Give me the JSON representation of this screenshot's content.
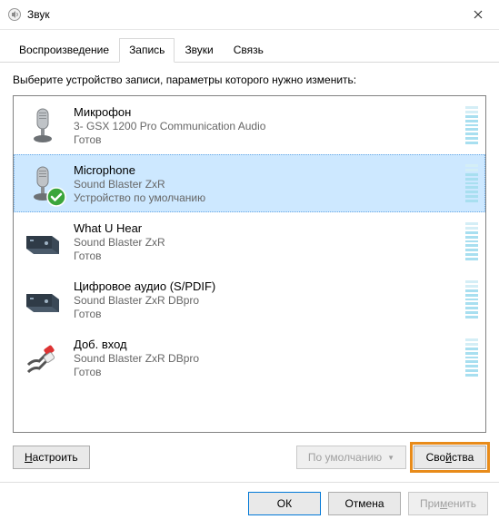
{
  "title": "Звук",
  "tabs": {
    "playback": "Воспроизведение",
    "recording": "Запись",
    "sounds": "Звуки",
    "communications": "Связь"
  },
  "active_tab": "recording",
  "prompt": "Выберите устройство записи, параметры которого нужно изменить:",
  "devices": [
    {
      "name": "Микрофон",
      "desc": "3- GSX 1200 Pro Communication Audio",
      "status": "Готов",
      "icon": "mic",
      "selected": false,
      "default": false
    },
    {
      "name": "Microphone",
      "desc": "Sound Blaster ZxR",
      "status": "Устройство по умолчанию",
      "icon": "mic",
      "selected": true,
      "default": true
    },
    {
      "name": "What U Hear",
      "desc": "Sound Blaster ZxR",
      "status": "Готов",
      "icon": "box",
      "selected": false,
      "default": false
    },
    {
      "name": "Цифровое аудио (S/PDIF)",
      "desc": "Sound Blaster ZxR DBpro",
      "status": "Готов",
      "icon": "box",
      "selected": false,
      "default": false
    },
    {
      "name": "Доб. вход",
      "desc": "Sound Blaster ZxR DBpro",
      "status": "Готов",
      "icon": "cable",
      "selected": false,
      "default": false
    }
  ],
  "buttons": {
    "configure": "Настроить",
    "default": "По умолчанию",
    "properties": "Свойства",
    "ok": "ОК",
    "cancel": "Отмена",
    "apply": "Применить"
  }
}
